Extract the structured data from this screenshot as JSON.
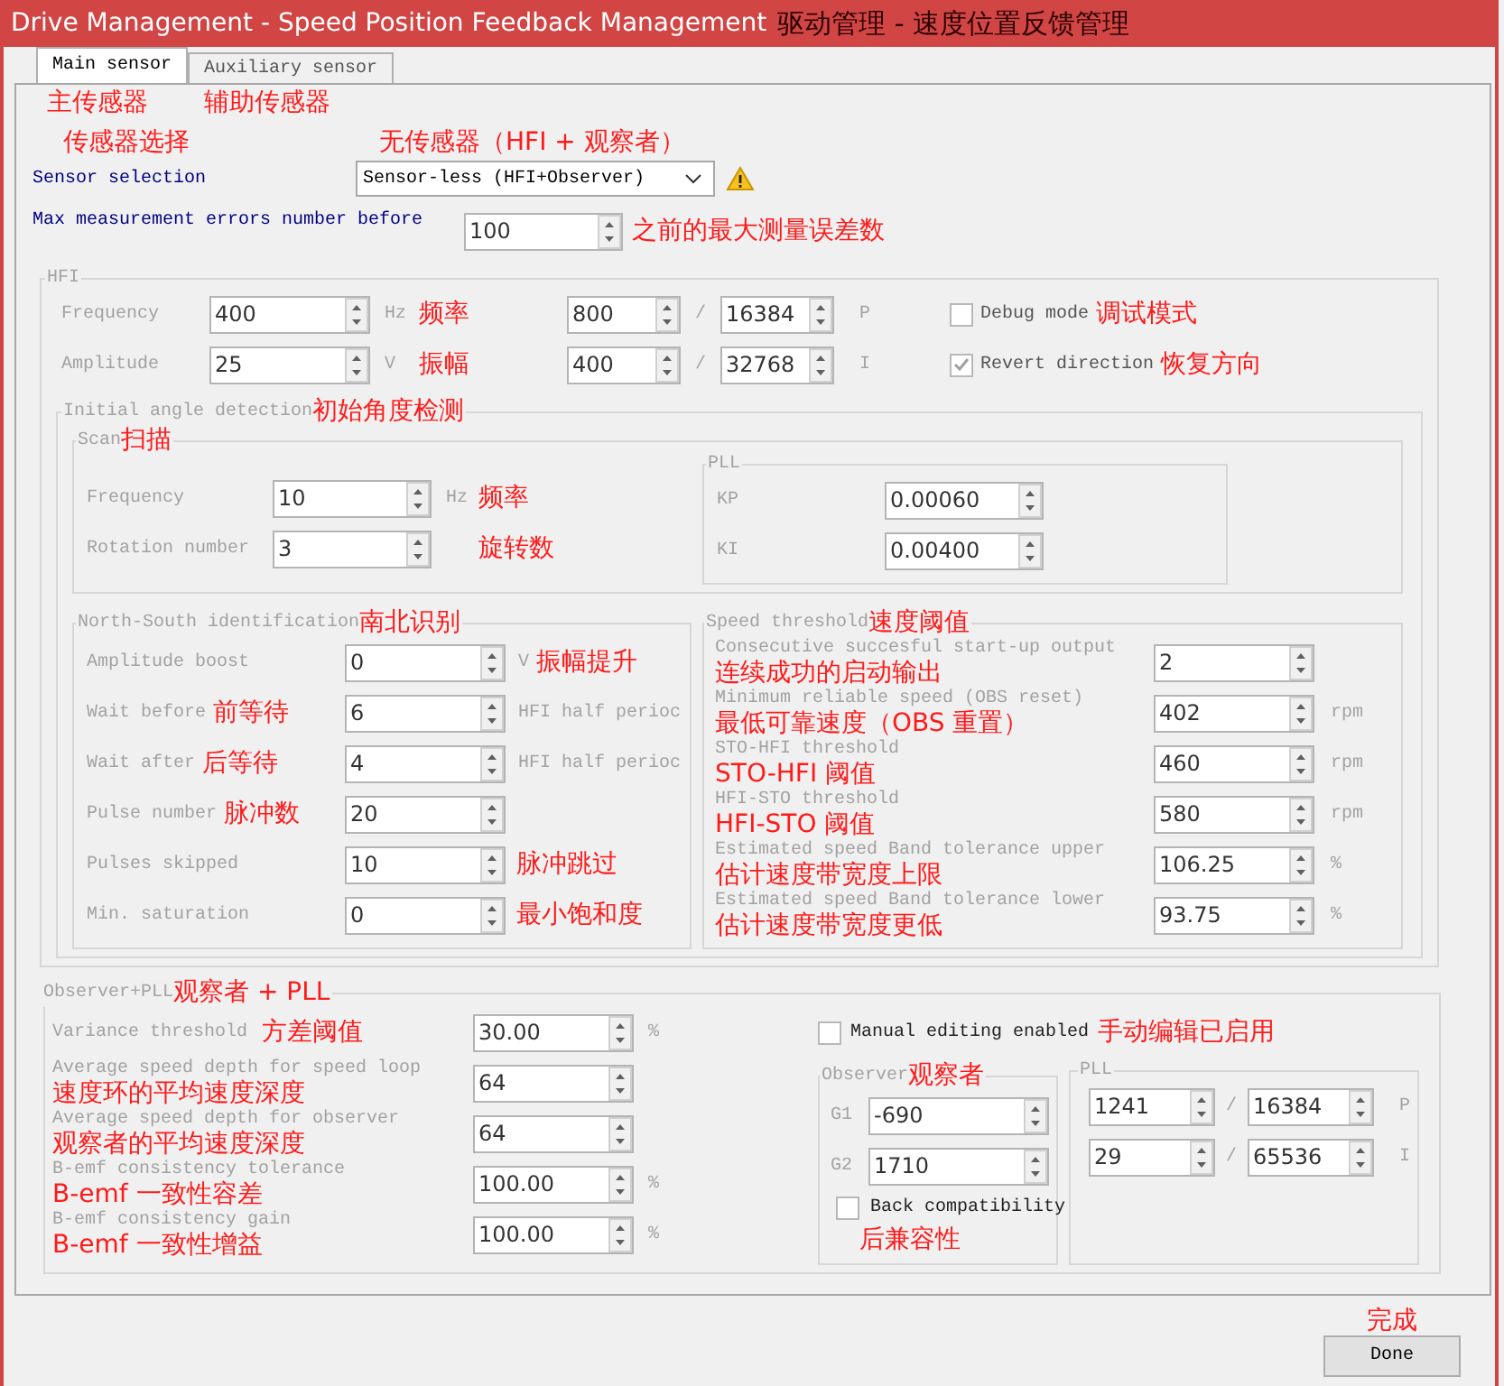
{
  "window": {
    "title": "Drive Management - Speed Position Feedback Management",
    "note": "驱动管理 - 速度位置反馈管理"
  },
  "tabs": [
    {
      "label": "Main sensor",
      "selected": true,
      "note": "主传感器"
    },
    {
      "label": "Auxiliary sensor",
      "selected": false,
      "note": "辅助传感器"
    }
  ],
  "sensor_selection": {
    "label": "Sensor selection",
    "label_note": "传感器选择",
    "value": "Sensor-less (HFI+Observer)",
    "value_note": "无传感器（HFI + 观察者）",
    "warning": true
  },
  "max_errors": {
    "label": "Max measurement errors number before",
    "value": "100",
    "note": "之前的最大测量误差数"
  },
  "hfi": {
    "title": "HFI",
    "rows": [
      {
        "label": "Frequency",
        "value": "400",
        "unit": "Hz",
        "note": "频率",
        "num": "800",
        "sep": "/",
        "den": "16384",
        "gain": "P"
      },
      {
        "label": "Amplitude",
        "value": "25",
        "unit": "V",
        "note": "振幅",
        "num": "400",
        "sep": "/",
        "den": "32768",
        "gain": "I"
      }
    ],
    "checks": [
      {
        "label": "Debug mode",
        "checked": false,
        "note": "调试模式"
      },
      {
        "label": "Revert direction",
        "checked": true,
        "note": "恢复方向"
      }
    ],
    "initial_angle": {
      "title": "Initial angle detection",
      "note": "初始角度检测",
      "scan": {
        "title": "Scan",
        "note": "扫描",
        "rows": [
          {
            "label": "Frequency",
            "value": "10",
            "unit": "Hz",
            "note": "频率"
          },
          {
            "label": "Rotation number",
            "value": "3",
            "note": "旋转数"
          }
        ],
        "pll": {
          "title": "PLL",
          "rows": [
            {
              "label": "KP",
              "value": "0.00060"
            },
            {
              "label": "KI",
              "value": "0.00400"
            }
          ]
        }
      },
      "north_south": {
        "title": "North-South identification",
        "note": "南北识别",
        "rows": [
          {
            "label": "Amplitude boost",
            "value": "0",
            "unit": "V",
            "note": "振幅提升"
          },
          {
            "label": "Wait before",
            "label_note": "前等待",
            "value": "6",
            "unit": "HFI half perioc"
          },
          {
            "label": "Wait after",
            "label_note": "后等待",
            "value": "4",
            "unit": "HFI half perioc"
          },
          {
            "label": "Pulse number",
            "label_note": "脉冲数",
            "value": "20"
          },
          {
            "label": "Pulses skipped",
            "value": "10",
            "note": "脉冲跳过"
          },
          {
            "label": "Min. saturation",
            "value": "0",
            "note": "最小饱和度"
          }
        ]
      },
      "speed_threshold": {
        "title": "Speed threshold",
        "note": "速度阈值",
        "rows": [
          {
            "label": "Consecutive succesful start-up output",
            "note": "连续成功的启动输出",
            "value": "2"
          },
          {
            "label": "Minimum reliable speed (OBS reset)",
            "note": "最低可靠速度（OBS 重置）",
            "value": "402",
            "unit": "rpm"
          },
          {
            "label": "STO-HFI threshold",
            "note": "STO-HFI 阈值",
            "value": "460",
            "unit": "rpm"
          },
          {
            "label": "HFI-STO threshold",
            "note": "HFI-STO 阈值",
            "value": "580",
            "unit": "rpm"
          },
          {
            "label": "Estimated speed Band tolerance upper",
            "note": "估计速度带宽度上限",
            "value": "106.25",
            "unit": "%"
          },
          {
            "label": "Estimated speed Band tolerance lower",
            "note": "估计速度带宽度更低",
            "value": "93.75",
            "unit": "%"
          }
        ]
      }
    }
  },
  "observer_pll": {
    "title": "Observer+PLL",
    "note": "观察者 + PLL",
    "rows": [
      {
        "label": "Variance threshold",
        "label_note": "方差阈值",
        "value": "30.00",
        "unit": "%"
      },
      {
        "label": "Average speed depth for speed loop",
        "note": "速度环的平均速度深度",
        "value": "64"
      },
      {
        "label": "Average speed depth for observer",
        "note": "观察者的平均速度深度",
        "value": "64"
      },
      {
        "label": "B-emf consistency tolerance",
        "note": "B-emf 一致性容差",
        "value": "100.00",
        "unit": "%"
      },
      {
        "label": "B-emf consistency gain",
        "note": "B-emf 一致性增益",
        "value": "100.00",
        "unit": "%"
      }
    ],
    "manual": {
      "label": "Manual editing enabled",
      "checked": false,
      "note": "手动编辑已启用"
    },
    "observer": {
      "title": "Observer",
      "note": "观察者",
      "rows": [
        {
          "label": "G1",
          "value": "-690"
        },
        {
          "label": "G2",
          "value": "1710"
        }
      ],
      "back": {
        "label": "Back compatibility",
        "checked": false,
        "note": "后兼容性"
      }
    },
    "pll": {
      "title": "PLL",
      "rows": [
        {
          "num": "1241",
          "sep": "/",
          "den": "16384",
          "gain": "P"
        },
        {
          "num": "29",
          "sep": "/",
          "den": "65536",
          "gain": "I"
        }
      ]
    }
  },
  "done": {
    "label": "Done",
    "note": "完成"
  }
}
